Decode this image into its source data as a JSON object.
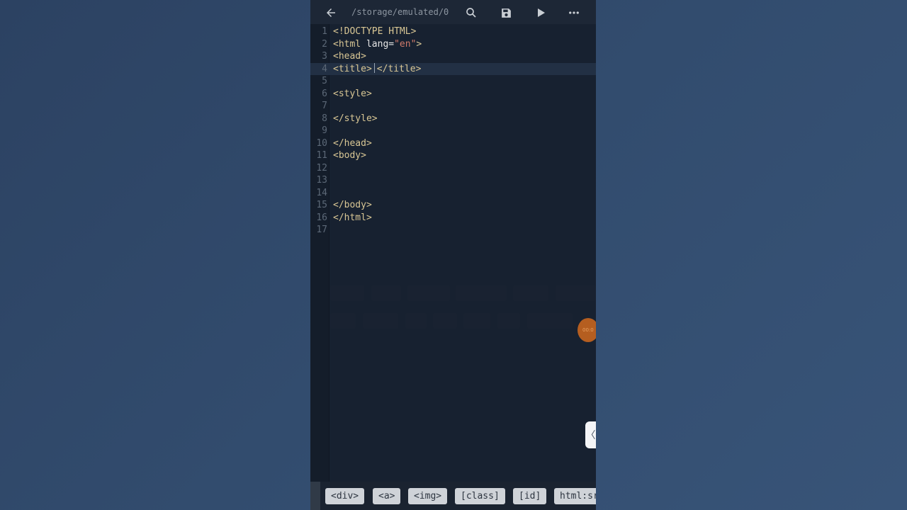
{
  "toolbar": {
    "back_icon": "arrow-left-icon",
    "path": "/storage/emulated/0",
    "search_icon": "search-icon",
    "save_icon": "save-icon",
    "run_icon": "play-icon",
    "more_icon": "more-horizontal-icon"
  },
  "editor": {
    "lines": [
      {
        "n": "1",
        "text": "<!DOCTYPE HTML>"
      },
      {
        "n": "2",
        "text": "<html lang=\"en\">"
      },
      {
        "n": "3",
        "text": "<head>"
      },
      {
        "n": "4",
        "text_before": "<title>",
        "text_after": "</title>",
        "active": true
      },
      {
        "n": "5",
        "text": ""
      },
      {
        "n": "6",
        "text": "<style>"
      },
      {
        "n": "7",
        "text": ""
      },
      {
        "n": "8",
        "text": "</style>"
      },
      {
        "n": "9",
        "text": ""
      },
      {
        "n": "10",
        "text": "</head>"
      },
      {
        "n": "11",
        "text": "<body>"
      },
      {
        "n": "12",
        "text": ""
      },
      {
        "n": "13",
        "text": ""
      },
      {
        "n": "14",
        "text": ""
      },
      {
        "n": "15",
        "text": "</body>"
      },
      {
        "n": "16",
        "text": "</html>"
      },
      {
        "n": "17",
        "text": ""
      }
    ]
  },
  "overlay": {
    "timer_text": "00:0",
    "side_tab_glyph": "〈"
  },
  "snippet_bar": {
    "chips": [
      "<div>",
      "<a>",
      "<img>",
      "[class]",
      "[id]",
      "html:sr"
    ]
  },
  "colors": {
    "editor_bg": "#172130",
    "tag": "#d9c795",
    "string": "#d07a6a",
    "fab": "#b55e20"
  }
}
